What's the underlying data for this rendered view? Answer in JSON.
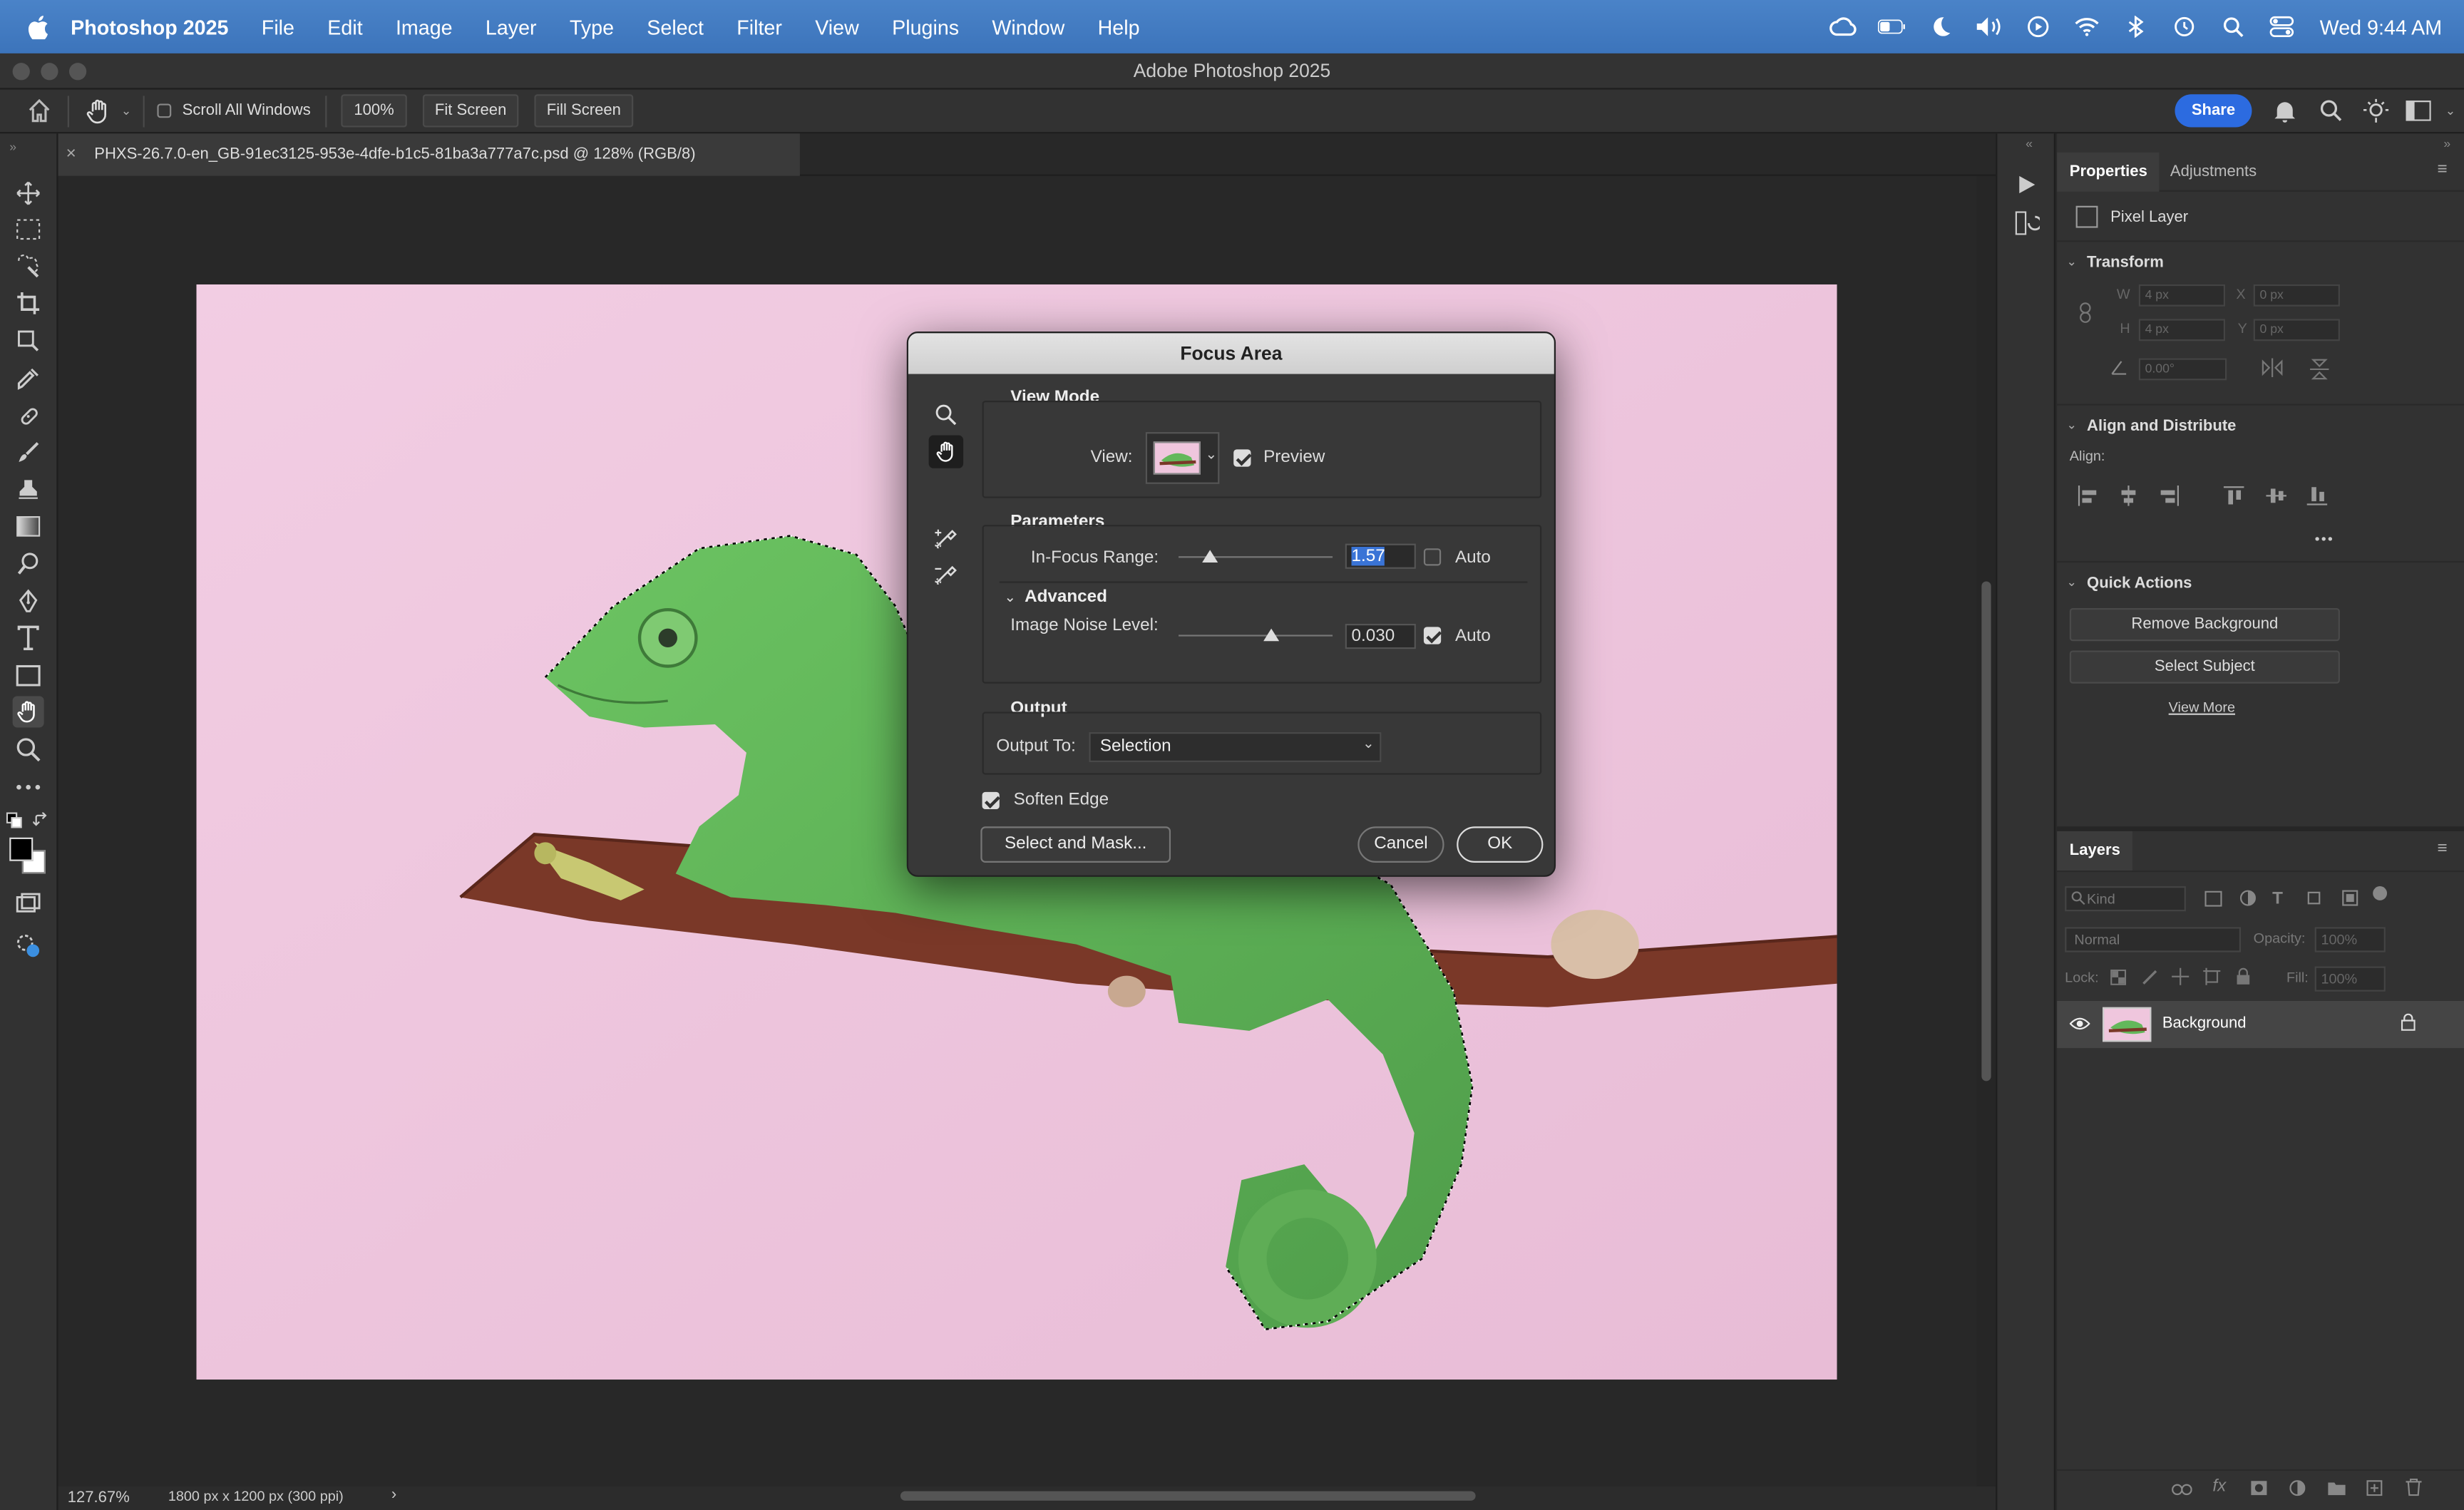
{
  "menubar": {
    "app": "Photoshop 2025",
    "items": [
      "File",
      "Edit",
      "Image",
      "Layer",
      "Type",
      "Select",
      "Filter",
      "View",
      "Plugins",
      "Window",
      "Help"
    ],
    "clock": "Wed 9:44 AM"
  },
  "window": {
    "title": "Adobe Photoshop 2025"
  },
  "options": {
    "scroll_all": "Scroll All Windows",
    "zoom": "100%",
    "fit_screen": "Fit Screen",
    "fill_screen": "Fill Screen",
    "share": "Share"
  },
  "document": {
    "tab": "PHXS-26.7.0-en_GB-91ec3125-953e-4dfe-b1c5-81ba3a777a7c.psd @ 128% (RGB/8)"
  },
  "status": {
    "zoom": "127.67%",
    "dims": "1800 px x 1200 px (300 ppi)",
    "arrow": "›"
  },
  "properties": {
    "tab_properties": "Properties",
    "tab_adjustments": "Adjustments",
    "layer_type": "Pixel Layer",
    "transform": "Transform",
    "w_label": "W",
    "w_val": "4 px",
    "x_label": "X",
    "x_val": "0 px",
    "h_label": "H",
    "h_val": "4 px",
    "y_label": "Y",
    "y_val": "0 px",
    "angle": "0.00°",
    "align_distribute": "Align and Distribute",
    "align": "Align:",
    "more": "•••",
    "quick_actions": "Quick Actions",
    "remove_bg": "Remove Background",
    "select_subject": "Select Subject",
    "view_more": "View More"
  },
  "layers": {
    "title": "Layers",
    "kind": "Kind",
    "blend": "Normal",
    "opacity_label": "Opacity:",
    "opacity": "100%",
    "lock": "Lock:",
    "fill_label": "Fill:",
    "fill": "100%",
    "layer_name": "Background"
  },
  "dialog": {
    "title": "Focus Area",
    "view_mode": "View Mode",
    "view_label": "View:",
    "preview": "Preview",
    "preview_checked": true,
    "parameters": "Parameters",
    "in_focus_label": "In-Focus Range:",
    "in_focus_value": "1.57",
    "in_focus_slider": 0.2,
    "auto1": "Auto",
    "auto1_checked": false,
    "advanced": "Advanced",
    "noise_label": "Image Noise Level:",
    "noise_value": "0.030",
    "noise_slider": 0.6,
    "auto2": "Auto",
    "auto2_checked": true,
    "output": "Output",
    "output_to_label": "Output To:",
    "output_to": "Selection",
    "soften_edge": "Soften Edge",
    "soften_checked": true,
    "select_mask": "Select and Mask...",
    "cancel": "Cancel",
    "ok": "OK"
  },
  "colors": {
    "accent": "#2c6be0",
    "menubar": "#4179c0",
    "canvas_bg": "#f0c8e0",
    "chameleon": "#5fb35a",
    "branch": "#7a3a2a"
  }
}
